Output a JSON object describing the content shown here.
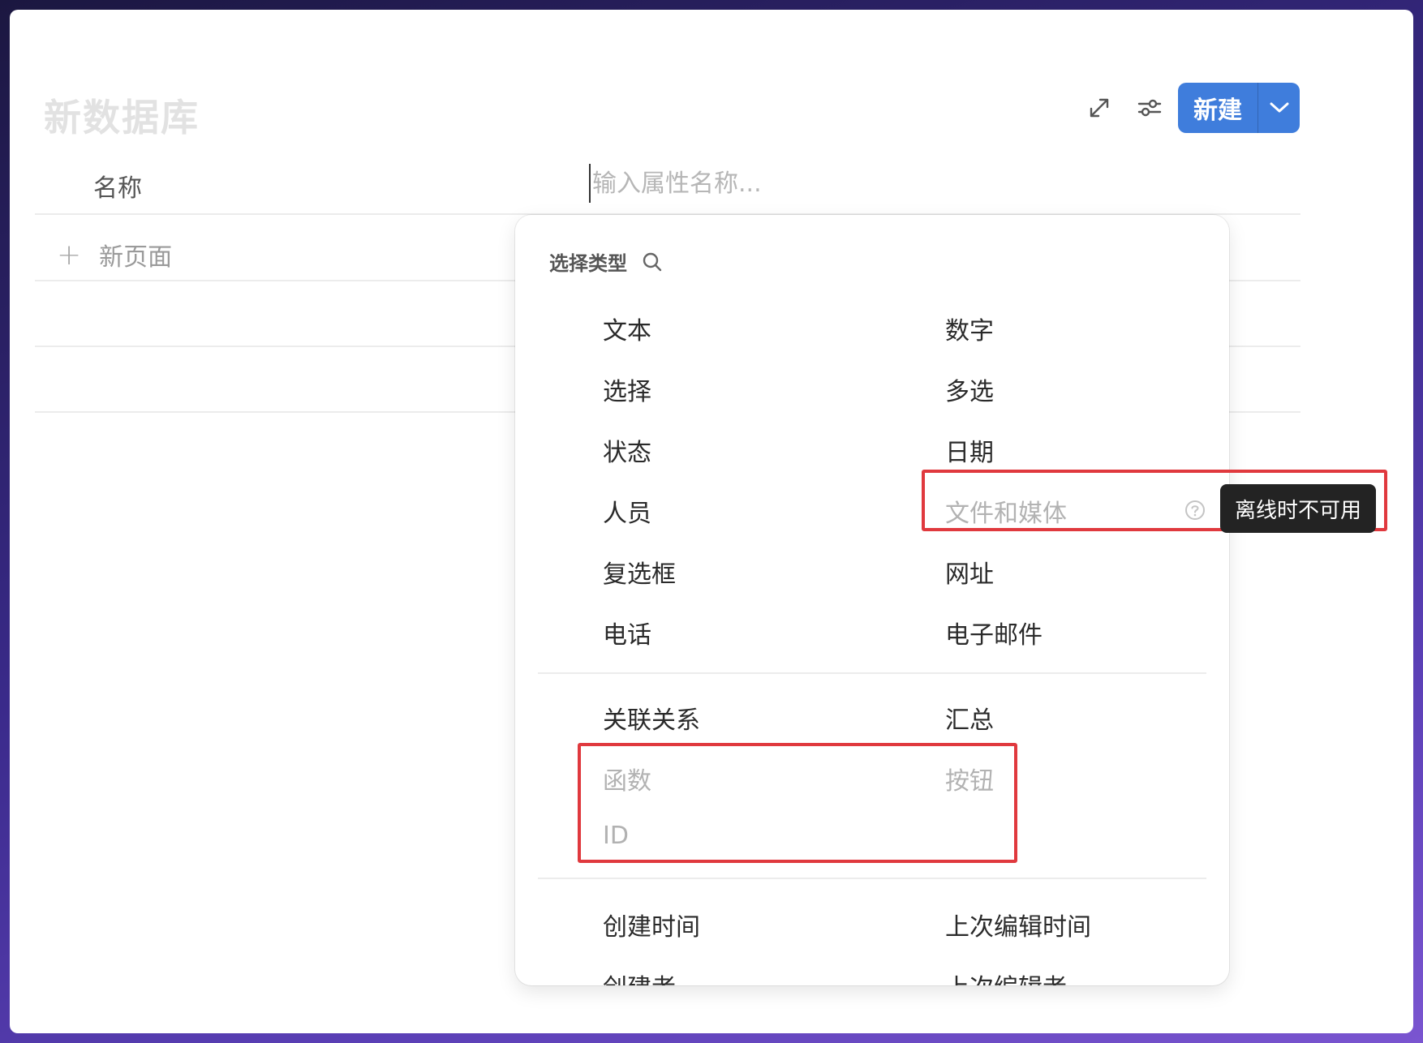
{
  "database": {
    "title": "新数据库"
  },
  "toolbar": {
    "expand_icon": "expand-icon",
    "settings_icon": "sliders-icon",
    "new_label": "新建",
    "new_dropdown_icon": "chevron-down-icon"
  },
  "table": {
    "name_column": "名称",
    "property_input_placeholder": "输入属性名称...",
    "new_page_label": "新页面"
  },
  "type_menu": {
    "header": "选择类型",
    "group1": [
      "文本",
      "数字",
      "选择",
      "多选",
      "状态",
      "日期",
      "人员",
      "文件和媒体",
      "复选框",
      "网址",
      "电话",
      "电子邮件"
    ],
    "group2": [
      "关联关系",
      "汇总",
      "函数",
      "按钮",
      "ID"
    ],
    "group3": [
      "创建时间",
      "上次编辑时间",
      "创建者",
      "上次编辑者"
    ],
    "disabled_items": [
      "文件和媒体",
      "函数",
      "按钮",
      "ID"
    ],
    "tooltip": "离线时不可用"
  },
  "colors": {
    "accent": "#3f7ddc",
    "highlight": "#e0393e",
    "tooltip_bg": "#232323"
  }
}
